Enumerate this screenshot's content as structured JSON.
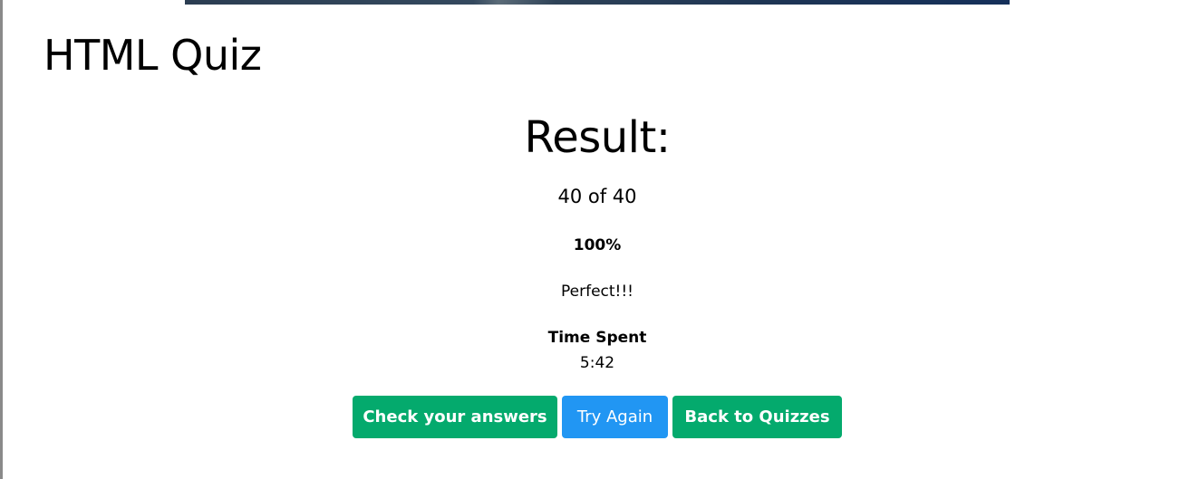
{
  "page": {
    "title": "HTML Quiz"
  },
  "result": {
    "heading": "Result:",
    "score_text": "40 of 40",
    "percent_text": "100%",
    "message": "Perfect!!!",
    "time_label": "Time Spent",
    "time_value": "5:42"
  },
  "actions": {
    "check_answers_label": "Check your answers",
    "try_again_label": "Try Again",
    "back_label": "Back to Quizzes"
  },
  "colors": {
    "primary_green": "#04aa6d",
    "primary_blue": "#2196f3",
    "banner_dark": "#1e3554"
  }
}
